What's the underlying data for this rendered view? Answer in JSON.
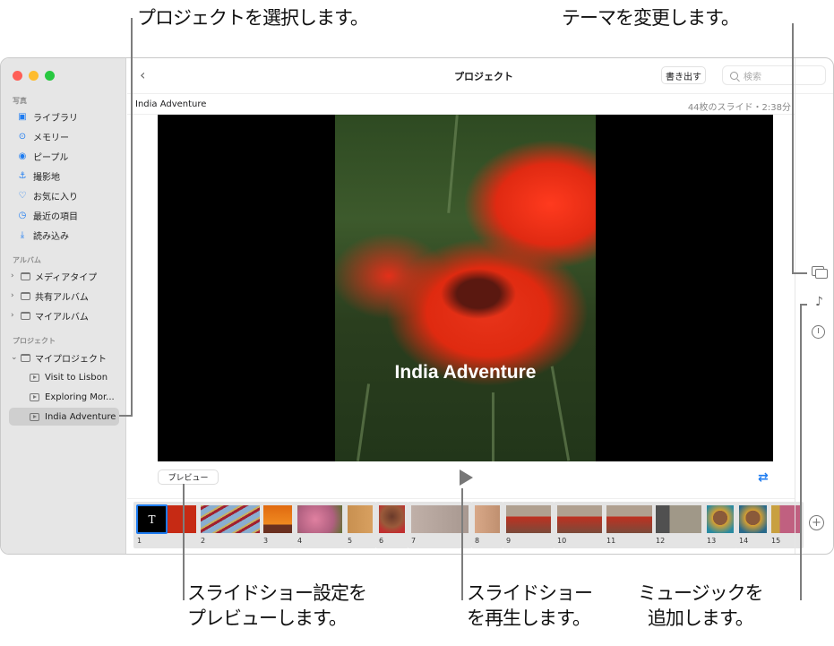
{
  "callouts": {
    "select_project": "プロジェクトを選択します。",
    "change_theme": "テーマを変更します。",
    "preview_line1": "スライドショー設定を",
    "preview_line2": "プレビューします。",
    "play_line1": "スライドショー",
    "play_line2": "を再生します。",
    "music_line1": "ミュージックを",
    "music_line2": "追加します。"
  },
  "sidebar": {
    "sections": [
      {
        "heading": "写真",
        "items": [
          {
            "label": "ライブラリ",
            "icon": "photo-library-icon"
          },
          {
            "label": "メモリー",
            "icon": "memories-icon"
          },
          {
            "label": "ピープル",
            "icon": "people-icon"
          },
          {
            "label": "撮影地",
            "icon": "places-icon"
          },
          {
            "label": "お気に入り",
            "icon": "heart-icon"
          },
          {
            "label": "最近の項目",
            "icon": "clock-icon"
          },
          {
            "label": "読み込み",
            "icon": "import-icon"
          }
        ]
      },
      {
        "heading": "アルバム",
        "items": [
          {
            "label": "メディアタイプ",
            "icon": "folder-icon"
          },
          {
            "label": "共有アルバム",
            "icon": "shared-folder-icon"
          },
          {
            "label": "マイアルバム",
            "icon": "folder-icon"
          }
        ]
      },
      {
        "heading": "プロジェクト",
        "items": [
          {
            "label": "マイプロジェクト",
            "icon": "folder-icon"
          },
          {
            "label": "Visit to Lisbon",
            "icon": "slideshow-icon"
          },
          {
            "label": "Exploring Mor...",
            "icon": "slideshow-icon"
          },
          {
            "label": "India Adventure",
            "icon": "slideshow-icon",
            "selected": true
          }
        ]
      }
    ]
  },
  "toolbar": {
    "title": "プロジェクト",
    "export_label": "書き出す",
    "search_placeholder": "検索"
  },
  "project": {
    "name": "India Adventure",
    "meta": "44枚のスライド・2:38分",
    "slide_title": "India Adventure"
  },
  "controls": {
    "preview_label": "プレビュー",
    "accent": "#1e7cf1"
  },
  "thumbnails": [
    {
      "n": "1",
      "kind": "title",
      "title_glyph": "T"
    },
    {
      "n": "2"
    },
    {
      "n": "3"
    },
    {
      "n": "4"
    },
    {
      "n": "5"
    },
    {
      "n": "6"
    },
    {
      "n": "7"
    },
    {
      "n": "8"
    },
    {
      "n": "9"
    },
    {
      "n": "10"
    },
    {
      "n": "11"
    },
    {
      "n": "12"
    },
    {
      "n": "13"
    },
    {
      "n": "14"
    },
    {
      "n": "15"
    }
  ]
}
